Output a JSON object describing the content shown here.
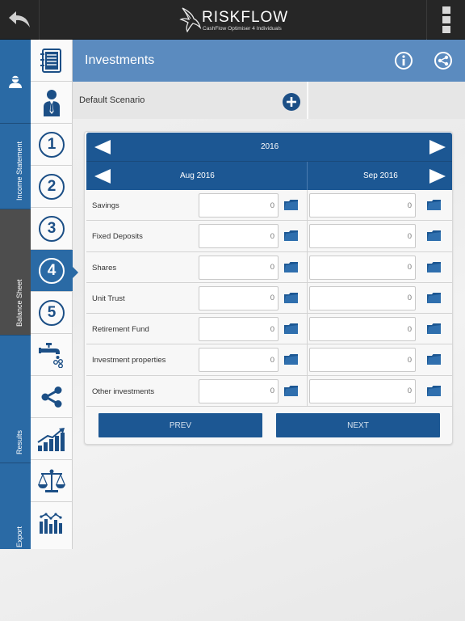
{
  "app": {
    "title": "RISKFLOW",
    "subtitle": "CashFlow Optimiser 4 Individuals"
  },
  "categories": [
    {
      "label": ""
    },
    {
      "label": "Income Statement"
    },
    {
      "label": "Balance Sheet"
    },
    {
      "label": "Results"
    },
    {
      "label": "Export"
    }
  ],
  "steps": [
    "1",
    "2",
    "3",
    "4",
    "5"
  ],
  "active_step": "4",
  "header": {
    "title": "Investments"
  },
  "scenario": {
    "name": "Default Scenario"
  },
  "period": {
    "year": "2016",
    "months": [
      "Aug 2016",
      "Sep 2016"
    ]
  },
  "rows": [
    {
      "label": "Savings",
      "values": [
        "0",
        "0"
      ]
    },
    {
      "label": "Fixed Deposits",
      "values": [
        "0",
        "0"
      ]
    },
    {
      "label": "Shares",
      "values": [
        "0",
        "0"
      ]
    },
    {
      "label": "Unit Trust",
      "values": [
        "0",
        "0"
      ]
    },
    {
      "label": "Retirement Fund",
      "values": [
        "0",
        "0"
      ]
    },
    {
      "label": "Investment properties",
      "values": [
        "0",
        "0"
      ]
    },
    {
      "label": "Other investments",
      "values": [
        "0",
        "0"
      ]
    }
  ],
  "buttons": {
    "prev": "PREV",
    "next": "NEXT"
  },
  "colors": {
    "topbar": "#262626",
    "primary": "#1c5793",
    "header": "#5b8bbf",
    "sidebar_blue": "#2a6aa5",
    "sidebar_dark": "#4d4d4d"
  }
}
